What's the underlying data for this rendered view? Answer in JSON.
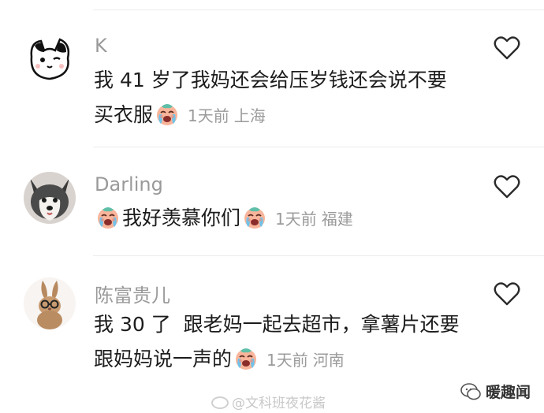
{
  "comments": [
    {
      "username": "K",
      "text_line1": "我 41 岁了我妈还会给压岁钱还会说不要",
      "text_line2": "买衣服",
      "time": "1天前",
      "location": "上海",
      "avatar_icon": "cartoon-cat-icon"
    },
    {
      "username": "Darling",
      "text_line1": "我好羡慕你们",
      "time": "1天前",
      "location": "福建",
      "avatar_icon": "husky-dog-icon"
    },
    {
      "username": "陈富贵儿",
      "text_line1": "我 30 了  跟老妈一起去超市，拿薯片还要",
      "text_line2": "跟妈妈说一声的",
      "time": "1天前",
      "location": "河南",
      "avatar_icon": "rabbit-glasses-icon"
    }
  ],
  "watermark": "@文科班夜花酱",
  "brand": {
    "label": "暖趣闻"
  },
  "colors": {
    "meta": "#9b9b9b",
    "username": "#9a9a9a",
    "emoji_face": "#f6a488"
  }
}
